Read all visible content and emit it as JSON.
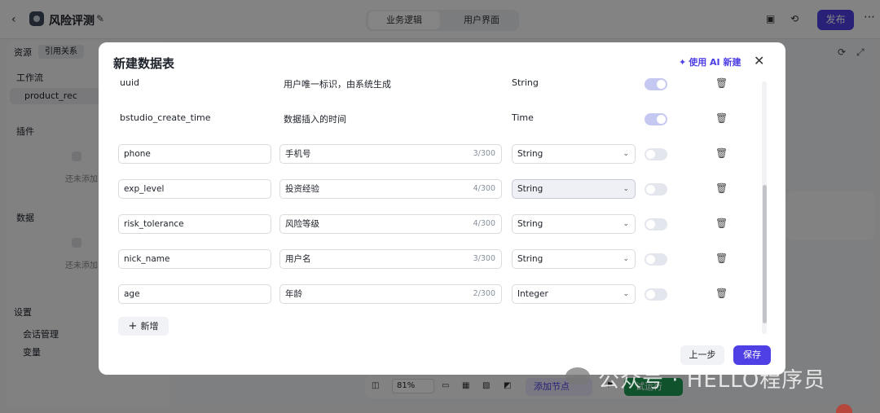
{
  "app": {
    "title": "风险评测",
    "tabs": [
      "业务逻辑",
      "用户界面"
    ],
    "publish_label": "发布"
  },
  "sidebar": {
    "resources_label": "资源",
    "references_label": "引用关系",
    "workflow_label": "工作流",
    "workflow_item": "product_rec",
    "plugins_label": "插件",
    "plugins_empty": "还未添加",
    "data_label": "数据",
    "data_empty": "还未添加",
    "settings_label": "设置",
    "session_mgmt": "会话管理",
    "variables": "变量"
  },
  "bottom_bar": {
    "zoom": "81%",
    "add_node": "添加节点",
    "run": "试运行"
  },
  "modal": {
    "title": "新建数据表",
    "ai_new_label": "使用 AI 新建",
    "system_fields": [
      {
        "name": "uuid",
        "desc": "用户唯一标识，由系统生成",
        "type": "String",
        "required": true
      },
      {
        "name": "bstudio_create_time",
        "desc": "数据插入的时间",
        "type": "Time",
        "required": true
      }
    ],
    "fields": [
      {
        "name": "phone",
        "desc": "手机号",
        "counter": "3/300",
        "type": "String",
        "required": false
      },
      {
        "name": "exp_level",
        "desc": "投资经验",
        "counter": "4/300",
        "type": "String",
        "required": false
      },
      {
        "name": "risk_tolerance",
        "desc": "风险等级",
        "counter": "4/300",
        "type": "String",
        "required": false
      },
      {
        "name": "nick_name",
        "desc": "用户名",
        "counter": "3/300",
        "type": "String",
        "required": false
      },
      {
        "name": "age",
        "desc": "年龄",
        "counter": "2/300",
        "type": "Integer",
        "required": false
      }
    ],
    "add_label": "新增",
    "prev_label": "上一步",
    "save_label": "保存"
  },
  "watermark": "公众号 · HELLO程序员",
  "colors": {
    "accent": "#4e40e5",
    "run_green": "#1f9d55"
  }
}
